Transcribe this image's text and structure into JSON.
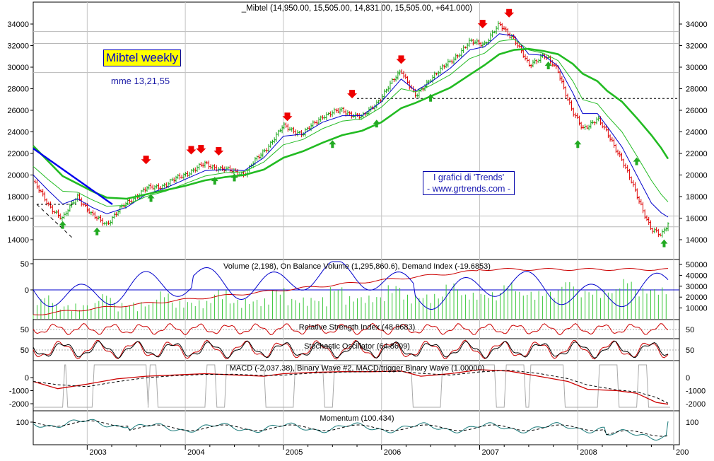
{
  "chart_data": [
    {
      "type": "line",
      "title": "_Mibtel (14,950.00, 15,505.00, 14,831.00, 15,505.00, +641.000)",
      "overlay_label": "Mibtel weekly",
      "ma_label": "mme 13,21,55",
      "credit_line1": "I grafici di 'Trends'",
      "credit_line2": "- www.grtrends.com -",
      "x_tick_labels": [
        "2003",
        "2004",
        "2005",
        "2006",
        "2007",
        "2008",
        "200"
      ],
      "ylim": [
        13200,
        35500
      ],
      "y_ticks": [
        14000,
        16000,
        18000,
        20000,
        22000,
        24000,
        26000,
        28000,
        30000,
        32000,
        34000
      ],
      "reference_levels": [
        27100
      ],
      "grid": true,
      "x": [
        2002.45,
        2002.6,
        2002.75,
        2002.9,
        2003.05,
        2003.2,
        2003.4,
        2003.6,
        2003.8,
        2004.0,
        2004.2,
        2004.4,
        2004.6,
        2004.8,
        2005.0,
        2005.2,
        2005.4,
        2005.6,
        2005.8,
        2006.0,
        2006.2,
        2006.35,
        2006.5,
        2006.7,
        2006.9,
        2007.05,
        2007.2,
        2007.35,
        2007.5,
        2007.65,
        2007.8,
        2007.95,
        2008.05,
        2008.2,
        2008.3,
        2008.45,
        2008.6,
        2008.75,
        2008.85,
        2008.92
      ],
      "series": [
        {
          "values": [
            19400,
            17300,
            15900,
            18100,
            16200,
            15500,
            17400,
            18700,
            19100,
            20100,
            21000,
            20500,
            20100,
            22200,
            24500,
            23800,
            25500,
            26000,
            25300,
            27200,
            29800,
            27200,
            29000,
            30500,
            32300,
            32200,
            33900,
            32700,
            30100,
            31200,
            29600,
            25800,
            24200,
            25300,
            23800,
            21500,
            18100,
            15000,
            14300,
            15500
          ]
        },
        {
          "values": [
            20000,
            18600,
            17300,
            17800,
            17000,
            16400,
            17000,
            18200,
            18800,
            19600,
            20400,
            20500,
            20400,
            21600,
            23600,
            23800,
            24900,
            25500,
            25500,
            26800,
            28900,
            27800,
            28600,
            29900,
            31600,
            31900,
            33100,
            32900,
            31200,
            31100,
            30100,
            27600,
            25700,
            25700,
            24500,
            22600,
            20000,
            17400,
            16500,
            16100
          ]
        },
        {
          "values": [
            20800,
            19600,
            18500,
            18400,
            17700,
            17100,
            17200,
            18000,
            18500,
            19200,
            19900,
            20200,
            20300,
            21200,
            22800,
            23300,
            24300,
            25000,
            25200,
            26300,
            28000,
            27700,
            28300,
            29300,
            30800,
            31300,
            32400,
            32600,
            31600,
            31300,
            30600,
            28700,
            27000,
            26600,
            25500,
            24000,
            21800,
            19500,
            18200,
            17500
          ]
        },
        {
          "values": [
            22700,
            21300,
            19900,
            19200,
            18500,
            17900,
            17800,
            18200,
            18600,
            19000,
            19500,
            19800,
            20000,
            20500,
            21600,
            22200,
            23000,
            23700,
            24100,
            24900,
            26200,
            26700,
            27300,
            28100,
            29300,
            30200,
            31200,
            31600,
            31700,
            31500,
            31200,
            30300,
            29400,
            28700,
            27800,
            26800,
            25300,
            23700,
            22500,
            21500
          ]
        }
      ]
    },
    {
      "type": "line",
      "title": "Volume (2,198), On Balance Volume (1,295,860.6), Demand Index (-19.6853)",
      "left_ticks": [
        "50",
        "0"
      ],
      "right_ticks": [
        "50000",
        "40000",
        "30000",
        "20000",
        "10000"
      ]
    },
    {
      "type": "line",
      "title": "Relative Strength Index (48.8683)",
      "y_tick_labels": [
        "50"
      ],
      "latest": 48.8683
    },
    {
      "type": "line",
      "title": "Stochastic Oscillator (64.8609)",
      "y_tick_labels": [
        "50"
      ],
      "latest": 64.8609
    },
    {
      "type": "line",
      "title": "MACD (-2,037.38), Binary Wave #2, MACD/trigger Binary Wave (1.00000)",
      "y_tick_labels": [
        "0",
        "-1000",
        "-2000"
      ],
      "x": [
        2002.45,
        2002.7,
        2003.0,
        2003.3,
        2003.6,
        2003.9,
        2004.2,
        2004.5,
        2004.8,
        2005.0,
        2005.3,
        2005.6,
        2005.9,
        2006.2,
        2006.4,
        2006.7,
        2007.0,
        2007.3,
        2007.6,
        2007.9,
        2008.1,
        2008.4,
        2008.6,
        2008.8,
        2008.92
      ],
      "values": [
        -300,
        -850,
        -500,
        -100,
        100,
        200,
        300,
        200,
        100,
        300,
        400,
        450,
        450,
        500,
        100,
        300,
        600,
        500,
        100,
        -300,
        -900,
        -1000,
        -1200,
        -1900,
        -2037
      ]
    },
    {
      "type": "line",
      "title": "Momentum (100.434)",
      "y_tick_labels": [
        "100"
      ],
      "latest": 100.434
    }
  ]
}
